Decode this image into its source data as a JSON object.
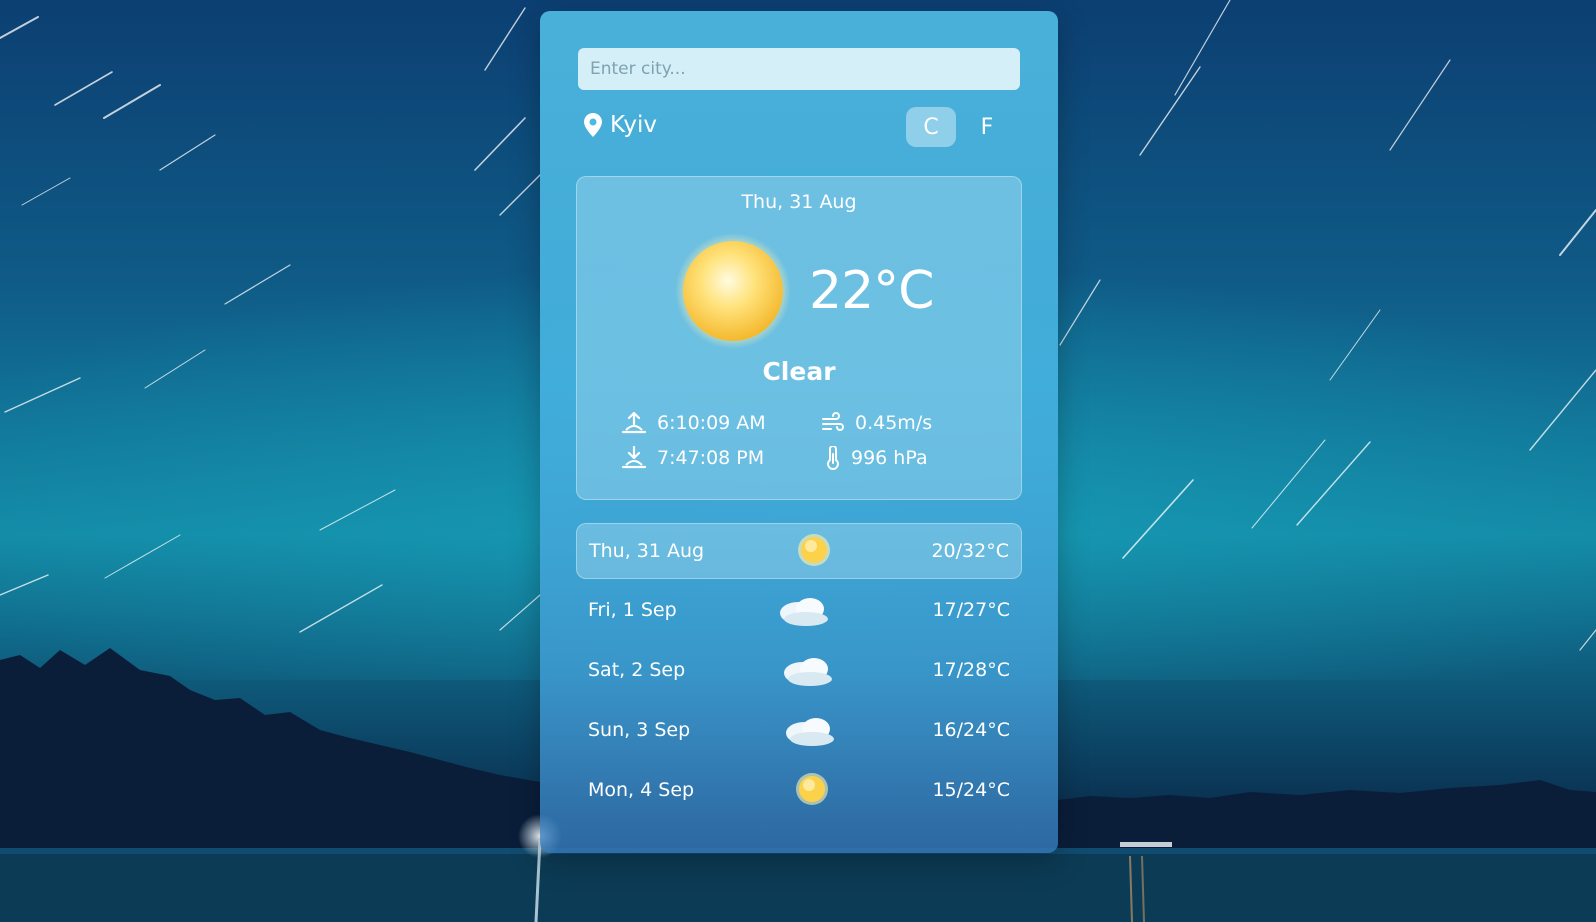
{
  "search": {
    "placeholder": "Enter city..."
  },
  "location": {
    "city": "Kyiv",
    "icon": "map-pin-icon"
  },
  "units": {
    "celsius_label": "C",
    "fahrenheit_label": "F",
    "active": "C"
  },
  "current": {
    "date": "Thu, 31 Aug",
    "temperature": "22°C",
    "condition": "Clear",
    "icon": "sun-icon",
    "sunrise": "6:10:09 AM",
    "sunset": "7:47:08 PM",
    "wind": "0.45m/s",
    "pressure": "996 hPa"
  },
  "forecast": [
    {
      "day": "Thu, 31 Aug",
      "range": "20/32°C",
      "icon": "sun-icon",
      "active": true
    },
    {
      "day": "Fri, 1 Sep",
      "range": "17/27°C",
      "icon": "cloud-icon",
      "active": false
    },
    {
      "day": "Sat, 2 Sep",
      "range": "17/28°C",
      "icon": "cloud-icon",
      "active": false
    },
    {
      "day": "Sun, 3 Sep",
      "range": "16/24°C",
      "icon": "cloud-icon",
      "active": false
    },
    {
      "day": "Mon, 4 Sep",
      "range": "15/24°C",
      "icon": "sun-icon",
      "active": false
    }
  ],
  "colors": {
    "card": "#4ebae2",
    "panel": "#a0d7ee",
    "sky_top": "#0c3f72",
    "horizon": "#138aa6"
  }
}
